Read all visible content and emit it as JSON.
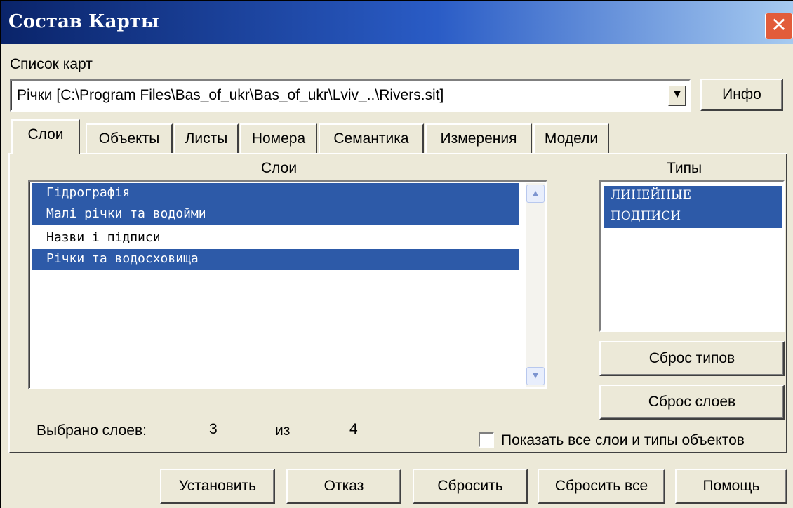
{
  "window": {
    "title": "Состав Карты",
    "close_glyph": "✕"
  },
  "map_list": {
    "label": "Список  карт",
    "selected_value": "Річки     [C:\\Program Files\\Bas_of_ukr\\Bas_of_ukr\\Lviv_..\\Rivers.sit]",
    "dropdown_glyph": "▼",
    "info_button": "Инфо"
  },
  "tabs": [
    {
      "label": "Слои",
      "active": true
    },
    {
      "label": "Объекты",
      "active": false
    },
    {
      "label": "Листы",
      "active": false
    },
    {
      "label": "Номера",
      "active": false
    },
    {
      "label": "Семантика",
      "active": false
    },
    {
      "label": "Измерения",
      "active": false
    },
    {
      "label": "Модели",
      "active": false
    }
  ],
  "layers": {
    "header": "Слои",
    "items": [
      {
        "label": "Гідрографія",
        "selected": true
      },
      {
        "label": "Малі річки та водойми",
        "selected": true
      },
      {
        "label": "Назви і підписи",
        "selected": false
      },
      {
        "label": "Річки та водосховища",
        "selected": true
      }
    ],
    "scroll_up": "▲",
    "scroll_down": "▼"
  },
  "types": {
    "header": "Типы",
    "items": [
      {
        "label": "ЛИНЕЙНЫЕ",
        "selected": true
      },
      {
        "label": "ПОДПИСИ",
        "selected": true
      }
    ],
    "reset_types_button": "Сброс типов",
    "reset_layers_button": "Сброс слоев"
  },
  "summary": {
    "selected_label": "Выбрано слоев:",
    "selected_count": "3",
    "of_label": "из",
    "total_count": "4"
  },
  "show_all": {
    "label": "Показать все слои и типы объектов",
    "checked": false
  },
  "footer": {
    "install": "Установить",
    "cancel": "Отказ",
    "reset": "Сбросить",
    "reset_all": "Сбросить все",
    "help": "Помощь"
  },
  "colors": {
    "selection": "#2d5aa8",
    "title_start": "#0a246a",
    "title_end": "#a6caf0",
    "dialog_bg": "#ece9d8"
  }
}
